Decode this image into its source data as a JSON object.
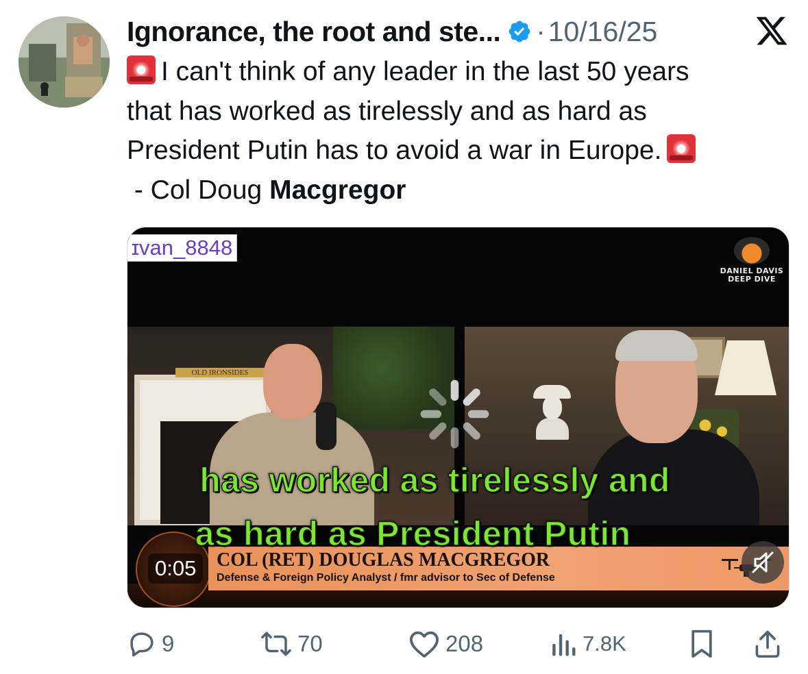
{
  "tweet": {
    "author_name": "Ignorance, the root and ste...",
    "separator": "·",
    "date": "10/16/25",
    "text_lines": [
      "I can't think of any leader in the last 50 years",
      "that has worked as tirelessly and as hard as",
      "President Putin has to avoid a war in Europe.",
      " - Col Doug "
    ],
    "text_bold_end": "Macgregor"
  },
  "media": {
    "watermark": "ɪvan_8848",
    "logo_line1": "DANIEL DAVIS",
    "logo_line2": "DEEP DIVE",
    "sign_text": "OLD IRONSIDES",
    "caption_line1": "has worked as tirelessly and",
    "caption_line2": "as hard as President Putin",
    "lower_third_name": "COL (RET) DOUGLAS MACGREGOR",
    "lower_third_title": "Defense & Foreign Policy Analyst / fmr advisor to Sec of Defense",
    "elapsed_time": "0:05",
    "muted": true
  },
  "actions": {
    "replies": "9",
    "reposts": "70",
    "likes": "208",
    "views": "7.8K"
  },
  "colors": {
    "text": "#0f1419",
    "secondary": "#536471",
    "verified_blue": "#1d9bf0",
    "caption_green": "#7be82f",
    "lower_third_orange": "#ee9a66",
    "siren_red": "#e0323a"
  },
  "icons": [
    "verified-badge-icon",
    "x-logo-icon",
    "siren-emoji-icon",
    "reply-icon",
    "repost-icon",
    "like-icon",
    "views-icon",
    "bookmark-icon",
    "share-icon",
    "muted-speaker-icon",
    "loading-spinner-icon"
  ]
}
